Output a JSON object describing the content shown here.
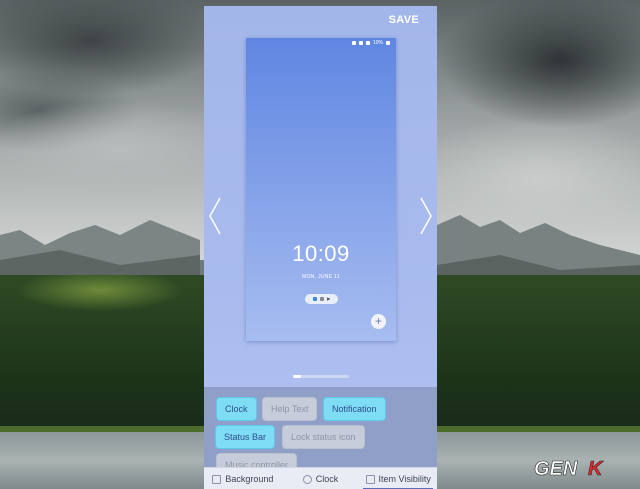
{
  "toolbar": {
    "save_label": "SAVE"
  },
  "lock_preview": {
    "status_text": "10%",
    "time": "10:09",
    "date": "MON, JUNE 11",
    "add_label": "+"
  },
  "items": {
    "clock": "Clock",
    "help_text": "Help Text",
    "notification": "Notification",
    "status_bar": "Status Bar",
    "lock_status_icon": "Lock status icon",
    "music_controller": "Music controller"
  },
  "tabs": [
    {
      "label": "Background",
      "icon": "image-icon"
    },
    {
      "label": "Clock",
      "icon": "clock-icon"
    },
    {
      "label": "Item Visibility",
      "icon": "eye-icon",
      "active": true
    }
  ],
  "watermark": {
    "text": "GENK"
  },
  "colors": {
    "chip_on": "#7fdcf5",
    "chip_off": "#c6ccd9",
    "panel": "#a3b6ea"
  }
}
